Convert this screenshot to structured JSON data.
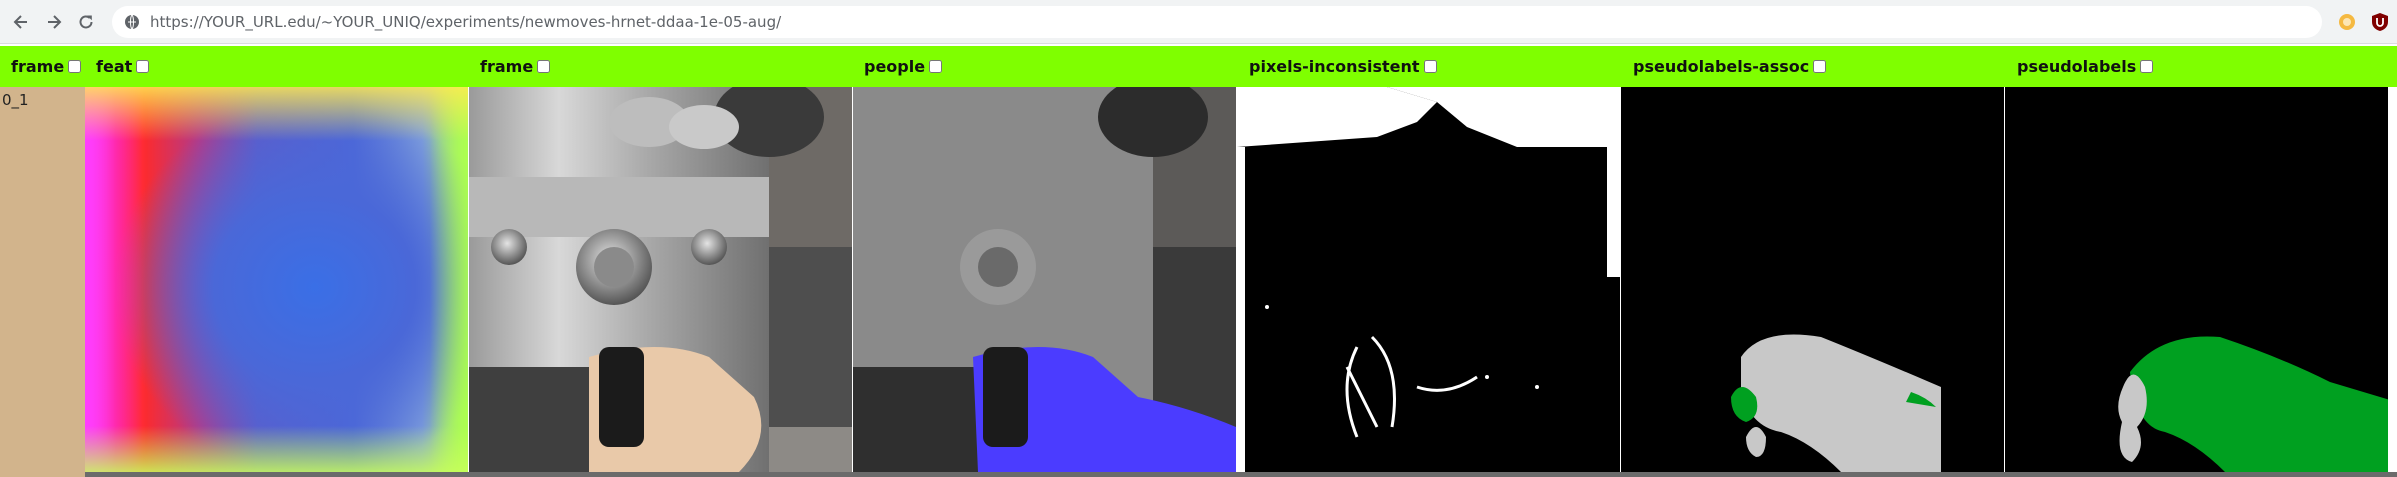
{
  "browser": {
    "url": "https://YOUR_URL.edu/~YOUR_UNIQ/experiments/newmoves-hrnet-ddaa-1e-05-aug/"
  },
  "table": {
    "headers": [
      {
        "label": "frame",
        "checked": false
      },
      {
        "label": "feat",
        "checked": false
      },
      {
        "label": "frame",
        "checked": false
      },
      {
        "label": "people",
        "checked": false
      },
      {
        "label": "pixels-inconsistent",
        "checked": false
      },
      {
        "label": "pseudolabels-assoc",
        "checked": false
      },
      {
        "label": "pseudolabels",
        "checked": false
      }
    ],
    "rows": [
      {
        "label": "0_1"
      }
    ]
  },
  "colors": {
    "header_bg": "#7fff00",
    "rowlabel_bg": "#d2b48c",
    "mask_hand": "#c8c8c8",
    "mask_green": "#00a020",
    "people_overlay": "#4b3cff"
  }
}
